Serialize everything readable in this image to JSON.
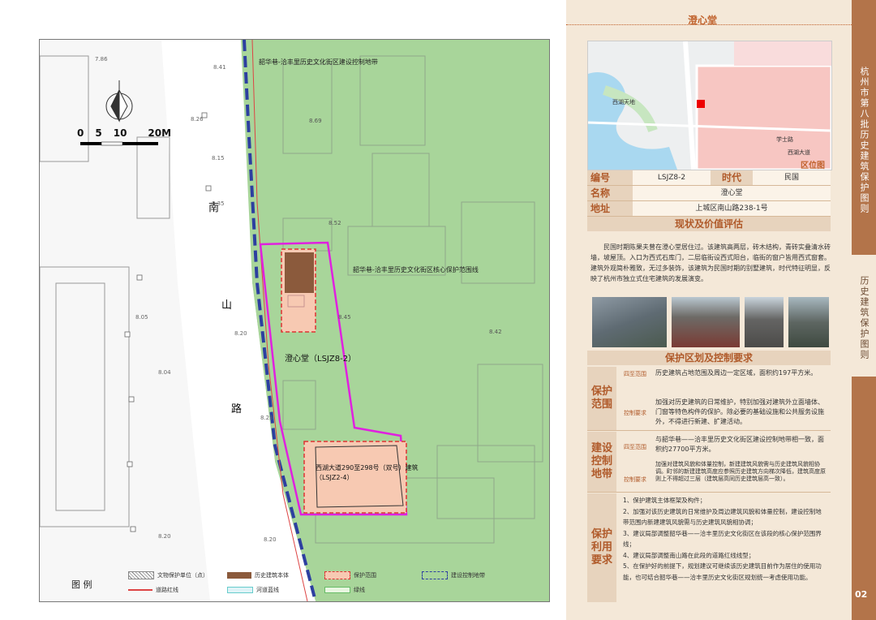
{
  "page_header": "澄心堂",
  "page_number": "02",
  "sidebar": {
    "top_title": "杭州市第八批历史建筑保护图则",
    "bottom_title": "历史建筑保护图则"
  },
  "map": {
    "scale_labels": [
      "0",
      "5",
      "10",
      "20M"
    ],
    "road_chars": [
      "南",
      "山",
      "路"
    ],
    "building_label": "澄心堂（LSJZ8-2）",
    "neighbor_label_line1": "西湖大道290至298号（双号）建筑",
    "neighbor_label_line2": "（LSJZ2-4）",
    "control_band_label": "韶华巷-洽丰里历史文化街区建设控制地带",
    "core_zone_label": "韶华巷-洽丰里历史文化街区核心保护范围线",
    "elevations": [
      "7.86",
      "8.41",
      "8.26",
      "8.15",
      "8.69",
      "8.35",
      "8.52",
      "8.45",
      "8.20",
      "8.05",
      "8.04",
      "8.23",
      "8.42",
      "8.20",
      "8.20"
    ]
  },
  "legend": {
    "title": "图  例",
    "items": [
      {
        "label": "文物保护单位（点）"
      },
      {
        "label": "历史建筑本体"
      },
      {
        "label": "保护范围"
      },
      {
        "label": "建设控制地带"
      },
      {
        "label": "道路红线"
      },
      {
        "label": "河道蓝线"
      },
      {
        "label": "绿线"
      }
    ]
  },
  "location_map": {
    "labels": [
      "西湖天地",
      "学士路",
      "西湖大道",
      "区位图"
    ]
  },
  "info_table": {
    "no_label": "编号",
    "no_value": "LSJZ8-2",
    "era_label": "时代",
    "era_value": "民国",
    "name_label": "名称",
    "name_value": "澄心堂",
    "addr_label": "地址",
    "addr_value": "上城区南山路238-1号"
  },
  "assessment": {
    "title": "现状及价值评估",
    "text": "民国时期陈果夫曾在澄心堂居住过。该建筑高两层，砖木结构，青砖实叠清水砖墙，坡屋顶。入口为西式石库门，二层临街设西式阳台，临街的窗户皆用西式窗套。建筑外观简朴雅致，无过多装饰，该建筑为民国时期的别墅建筑，时代特征明显，反映了杭州市独立式住宅建筑的发展演变。"
  },
  "control": {
    "title": "保护区划及控制要求",
    "protect_label": "保护范围",
    "build_label": "建设控制地带",
    "req_label": "保护利用要求",
    "sub_scope": "四至范围",
    "sub_req": "控制要求",
    "protect_scope_text": "历史建筑占地范围及周边一定区域，面积约197平方米。",
    "protect_req_text": "加强对历史建筑的日常维护，特别加强对建筑外立面墙体、门窗等特色构件的保护。除必要的基础设施和公共服务设施外，不得进行新建、扩建活动。",
    "build_scope_text": "与韶华巷——洽丰里历史文化街区建设控制地带相一致，面积约27700平方米。",
    "build_req_text": "加强对建筑风貌和体量控制，新建建筑风貌需与历史建筑风貌相协调。町邻的新建建筑高度应参照历史建筑方向梯次降低，建筑高度原则上不得超过三层（建筑层高同历史建筑层高一致）。",
    "req_items": [
      "1、保护建筑主体框架及构件；",
      "2、加强对该历史建筑的日常维护及周边建筑风貌和体量控制，建设控制地带范围内新建建筑风貌需与历史建筑风貌相协调；",
      "3、建议局部调整韶华巷——洽丰里历史文化街区在该段的核心保护范围界线；",
      "4、建议局部调整南山路在此段的道路红线线型；",
      "5、在保护好的前提下，规划建议可继续该历史建筑目前作为居住的使用功能，也可结合韶华巷——洽丰里历史文化街区规划统一考虑使用功能。"
    ]
  },
  "colors": {
    "accent": "#c0612b",
    "sidebar": "#b3744a",
    "panel_bg": "#f4e8d8",
    "green_zone": "#a8d59a",
    "building": "#8b5a3c",
    "magenta": "#e020e0"
  }
}
